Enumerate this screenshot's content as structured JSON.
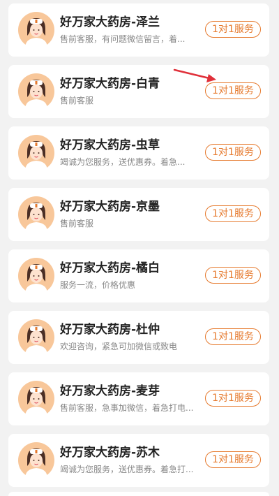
{
  "colors": {
    "accent": "#e67a2e",
    "page_bg": "#f2f2f2",
    "annotation_arrow": "#e0303a"
  },
  "service_list": [
    {
      "avatar_icon": "nurse-avatar-icon",
      "name": "好万家大药房-泽兰",
      "description": "售前客服，有问题微信留言，着...",
      "button": "1对1服务"
    },
    {
      "avatar_icon": "nurse-avatar-icon",
      "name": "好万家大药房-白青",
      "description": "售前客服",
      "button": "1对1服务"
    },
    {
      "avatar_icon": "nurse-avatar-icon",
      "name": "好万家大药房-虫草",
      "description": "竭诚为您服务，送优惠券。着急...",
      "button": "1对1服务"
    },
    {
      "avatar_icon": "nurse-avatar-icon",
      "name": "好万家大药房-京墨",
      "description": "售前客服",
      "button": "1对1服务"
    },
    {
      "avatar_icon": "nurse-avatar-icon",
      "name": "好万家大药房-橘白",
      "description": "服务一流，价格优惠",
      "button": "1对1服务"
    },
    {
      "avatar_icon": "nurse-avatar-icon",
      "name": "好万家大药房-杜仲",
      "description": "欢迎咨询，紧急可加微信或致电",
      "button": "1对1服务"
    },
    {
      "avatar_icon": "nurse-avatar-icon",
      "name": "好万家大药房-麦芽",
      "description": "售前客服，急事加微信，着急打电...",
      "button": "1对1服务"
    },
    {
      "avatar_icon": "nurse-avatar-icon",
      "name": "好万家大药房-苏木",
      "description": "竭诚为您服务，送优惠券。着急打...",
      "button": "1对1服务"
    }
  ]
}
